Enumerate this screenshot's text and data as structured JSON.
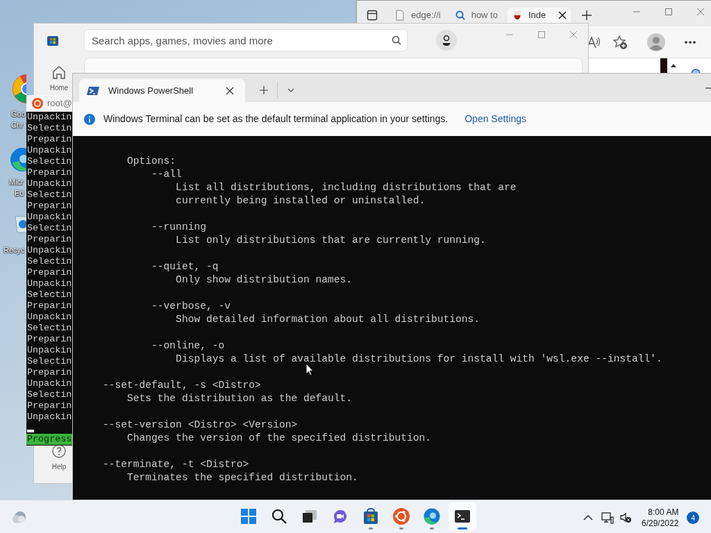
{
  "desktop_icons": [
    {
      "kind": "chrome",
      "label_lines": [
        "Goo",
        "Chr"
      ]
    },
    {
      "kind": "edge",
      "label_lines": [
        "Micr",
        "Ed"
      ]
    },
    {
      "kind": "recycle",
      "label_lines": [
        "Recyc"
      ]
    }
  ],
  "edge_window": {
    "tabs": [
      {
        "label": "edge://i",
        "kind": "page",
        "selected": false
      },
      {
        "label": "how to",
        "kind": "search",
        "selected": false
      },
      {
        "label": "Inde",
        "kind": "site",
        "selected": true
      }
    ]
  },
  "store_window": {
    "search": {
      "placeholder": "Search apps, games, movies and more"
    },
    "nav": [
      {
        "label": "Home",
        "kind": "home"
      },
      {
        "label": "Help",
        "kind": "help"
      }
    ]
  },
  "ubuntu_window": {
    "title": "root@",
    "lines": [
      "Unpackin",
      "Selectin",
      "Preparin",
      "Unpackin",
      "Selectin",
      "Preparin",
      "Unpackin",
      "Selectin",
      "Preparin",
      "Unpackin",
      "Selectin",
      "Preparin",
      "Unpackin",
      "Selectin",
      "Preparin",
      "Unpackin",
      "Selectin",
      "Preparin",
      "Unpackin",
      "Selectin",
      "Preparin",
      "Unpackin",
      "Selectin",
      "Preparin",
      "Unpackin",
      "Selectin",
      "Preparin",
      "Unpackin"
    ],
    "progress": "Progress"
  },
  "terminal_window": {
    "tabs": [
      {
        "label": "Windows PowerShell",
        "selected": true
      }
    ],
    "infobar": {
      "message": "Windows Terminal can be set as the default terminal application in your settings.",
      "link": "Open Settings"
    },
    "blocks": [
      [
        "        Options:",
        "            --all",
        "                List all distributions, including distributions that are",
        "                currently being installed or uninstalled."
      ],
      [
        "            --running",
        "                List only distributions that are currently running."
      ],
      [
        "            --quiet, -q",
        "                Only show distribution names."
      ],
      [
        "            --verbose, -v",
        "                Show detailed information about all distributions."
      ],
      [
        "            --online, -o",
        "                Displays a list of available distributions for install with 'wsl.exe --install'."
      ],
      [
        "    --set-default, -s <Distro>",
        "        Sets the distribution as the default."
      ],
      [
        "    --set-version <Distro> <Version>",
        "        Changes the version of the specified distribution."
      ],
      [
        "    --terminate, -t <Distro>",
        "        Terminates the specified distribution."
      ]
    ]
  },
  "taskbar": {
    "apps": [
      {
        "kind": "start",
        "running": false,
        "selected": false
      },
      {
        "kind": "search",
        "running": false,
        "selected": false
      },
      {
        "kind": "taskview",
        "running": false,
        "selected": false
      },
      {
        "kind": "chat",
        "running": false,
        "selected": false
      },
      {
        "kind": "store",
        "running": true,
        "selected": false
      },
      {
        "kind": "ubuntu",
        "running": true,
        "selected": false
      },
      {
        "kind": "edge",
        "running": true,
        "selected": false
      },
      {
        "kind": "terminal",
        "running": true,
        "selected": true
      }
    ],
    "clock": {
      "time": "8:00 AM",
      "date": "6/29/2022"
    },
    "notification_count": "4"
  }
}
